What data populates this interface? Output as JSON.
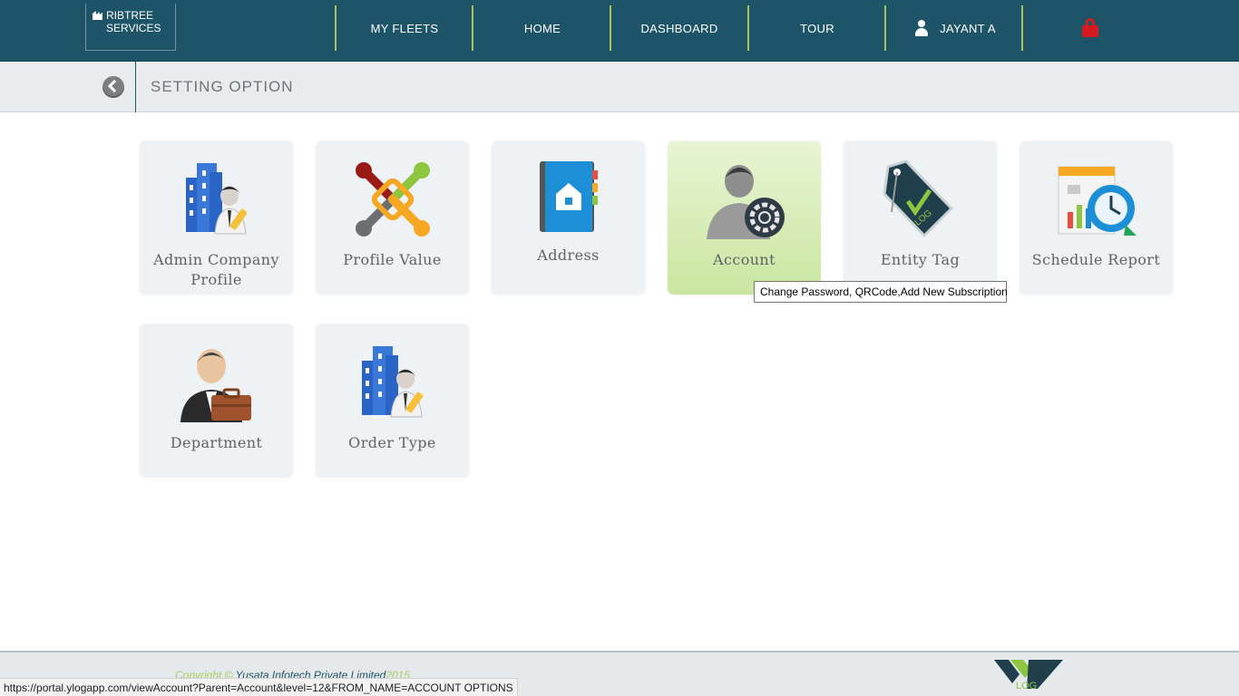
{
  "brand": {
    "line1": "RIBTREE",
    "line2": "SERVICES"
  },
  "nav": {
    "items": [
      {
        "label": "MY FLEETS"
      },
      {
        "label": "HOME"
      },
      {
        "label": "DASHBOARD"
      },
      {
        "label": "TOUR"
      }
    ],
    "user": {
      "label": "JAYANT A",
      "icon": "user-icon"
    },
    "logout_icon": "lock-icon"
  },
  "subheader": {
    "title": "SETTING OPTION",
    "back_icon": "back-arrow-icon"
  },
  "tiles": [
    {
      "label": "Admin Company Profile",
      "icon": "company-profile-icon"
    },
    {
      "label": "Profile Value",
      "icon": "profile-value-icon"
    },
    {
      "label": "Address",
      "icon": "address-book-icon"
    },
    {
      "label": "Account",
      "icon": "account-settings-icon",
      "active": true
    },
    {
      "label": "Entity Tag",
      "icon": "tag-icon"
    },
    {
      "label": "Schedule Report",
      "icon": "schedule-report-icon"
    },
    {
      "label": "Department",
      "icon": "department-icon"
    },
    {
      "label": "Order Type",
      "icon": "order-type-icon"
    }
  ],
  "tooltip": {
    "text": "Change Password, QRCode,Add New Subscription"
  },
  "footer": {
    "copyright_prefix": "Copyright © ",
    "company": "Yusata Infotech Private Limited",
    "year": "2015",
    "logo_text": "LOG"
  },
  "statusbar": {
    "url": "https://portal.ylogapp.com/viewAccount?Parent=Account&level=12&FROM_NAME=ACCOUNT OPTIONS"
  },
  "colors": {
    "topbar": "#1d5468",
    "nav_separator": "#a7c35c",
    "active_tile": "#c9e6a0",
    "lock": "#d71920"
  }
}
